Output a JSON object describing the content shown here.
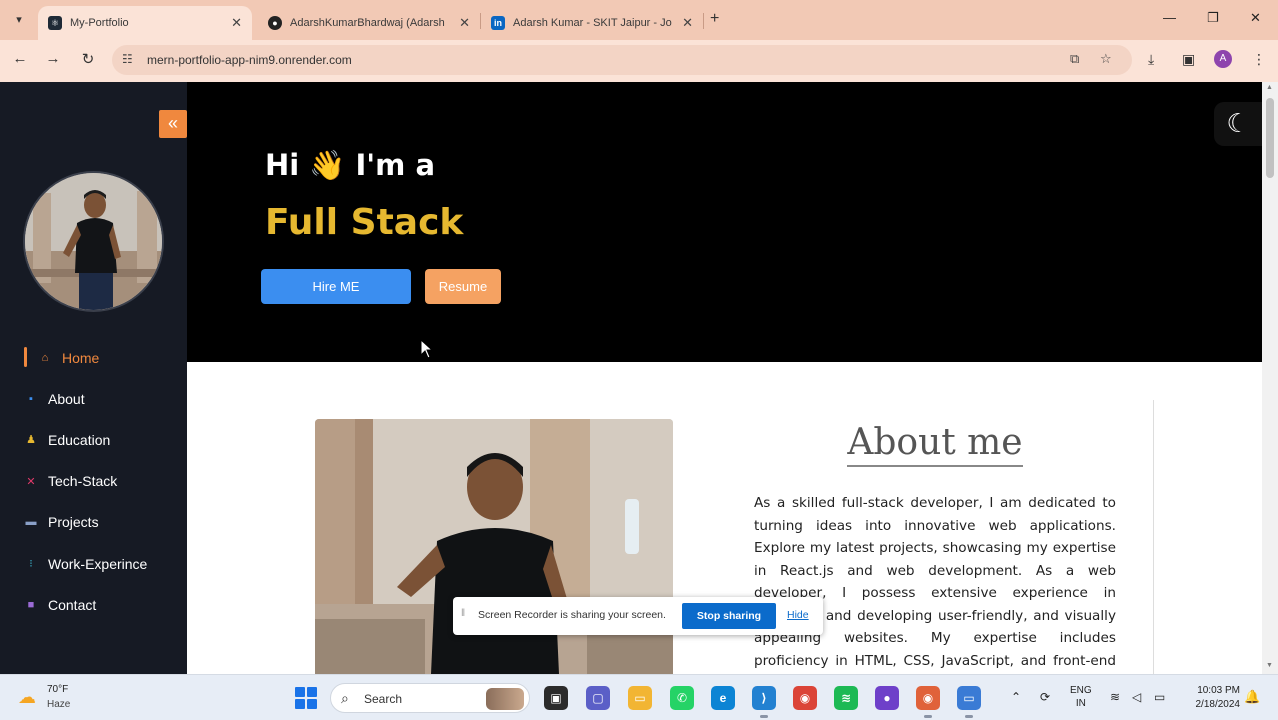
{
  "browser": {
    "tabs": [
      {
        "title": "My-Portfolio",
        "active": true
      },
      {
        "title": "AdarshKumarBhardwaj (Adarsh",
        "active": false
      },
      {
        "title": "Adarsh Kumar - SKIT Jaipur - Jo",
        "active": false
      }
    ],
    "url": "mern-portfolio-app-nim9.onrender.com",
    "profile_initial": "A"
  },
  "sidebar": {
    "collapse_glyph": "«",
    "nav": [
      {
        "label": "Home",
        "active": true
      },
      {
        "label": "About"
      },
      {
        "label": "Education"
      },
      {
        "label": "Tech-Stack"
      },
      {
        "label": "Projects"
      },
      {
        "label": "Work-Experince"
      },
      {
        "label": "Contact"
      }
    ]
  },
  "hero": {
    "greeting": "Hi 👋 I'm a",
    "role": "Full Stack",
    "hire_label": "Hire ME",
    "resume_label": "Resume"
  },
  "about": {
    "title": "About me",
    "text": "As a skilled full-stack developer, I am dedicated to turning ideas into innovative web applications. Explore my latest projects, showcasing my expertise in React.js and web development. As a web developer, I possess extensive experience in designing and developing user-friendly, and visually appealing websites. My expertise includes proficiency in HTML, CSS, JavaScript, and front-end frameworks such as"
  },
  "screen_recorder": {
    "message": "Screen Recorder is sharing your screen.",
    "stop_label": "Stop sharing",
    "hide_label": "Hide"
  },
  "taskbar": {
    "weather_temp": "70°F",
    "weather_desc": "Haze",
    "search_label": "Search",
    "lang_line1": "ENG",
    "lang_line2": "IN",
    "time": "10:03 PM",
    "date": "2/18/2024"
  },
  "colors": {
    "accent_orange": "#f0883e",
    "hero_yellow": "#e6b830",
    "hire_blue": "#3b8ef0",
    "sidebar_bg": "#161a24"
  }
}
